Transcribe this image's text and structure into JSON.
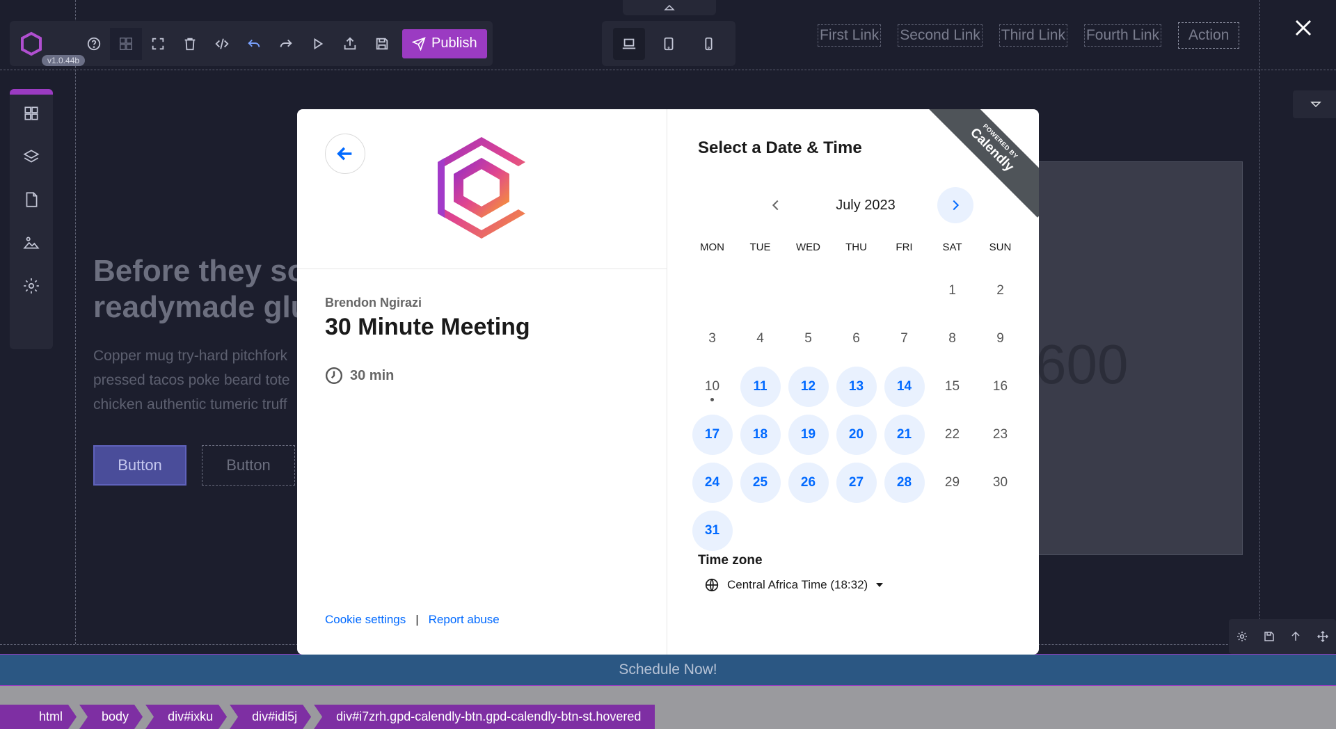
{
  "editor": {
    "version": "v1.0.44b",
    "publish_label": "Publish",
    "nav_links": [
      "First Link",
      "Second Link",
      "Third Link",
      "Fourth Link"
    ],
    "nav_action": "Action",
    "hero_title_line1": "Before they so",
    "hero_title_line2": "readymade glu",
    "hero_text_line1": "Copper mug try-hard pitchfork",
    "hero_text_line2": "pressed tacos poke beard tote",
    "hero_text_line3": "chicken authentic tumeric truff",
    "button_primary": "Button",
    "button_secondary": "Button",
    "stat_number": "600",
    "schedule_label": "Schedule Now!",
    "breadcrumb": [
      "html",
      "body",
      "div#ixku",
      "div#idi5j",
      "div#i7zrh.gpd-calendly-btn.gpd-calendly-btn-st.hovered"
    ],
    "accent_color": "#9b3bc2"
  },
  "calendly": {
    "organizer": "Brendon Ngirazi",
    "event_title": "30 Minute Meeting",
    "duration": "30 min",
    "footer_cookie": "Cookie settings",
    "footer_sep": "|",
    "footer_report": "Report abuse",
    "select_title": "Select a Date & Time",
    "month": "July 2023",
    "weekdays": [
      "MON",
      "TUE",
      "WED",
      "THU",
      "FRI",
      "SAT",
      "SUN"
    ],
    "timezone_label": "Time zone",
    "timezone_value": "Central Africa Time (18:32)",
    "ribbon_small": "POWERED BY",
    "ribbon_big": "Calendly",
    "brand_blue": "#0069ff",
    "days": [
      {
        "d": "",
        "a": false
      },
      {
        "d": "",
        "a": false
      },
      {
        "d": "",
        "a": false
      },
      {
        "d": "",
        "a": false
      },
      {
        "d": "",
        "a": false
      },
      {
        "d": "1",
        "a": false
      },
      {
        "d": "2",
        "a": false
      },
      {
        "d": "3",
        "a": false
      },
      {
        "d": "4",
        "a": false
      },
      {
        "d": "5",
        "a": false
      },
      {
        "d": "6",
        "a": false
      },
      {
        "d": "7",
        "a": false
      },
      {
        "d": "8",
        "a": false
      },
      {
        "d": "9",
        "a": false
      },
      {
        "d": "10",
        "a": false,
        "today": true
      },
      {
        "d": "11",
        "a": true
      },
      {
        "d": "12",
        "a": true
      },
      {
        "d": "13",
        "a": true
      },
      {
        "d": "14",
        "a": true
      },
      {
        "d": "15",
        "a": false
      },
      {
        "d": "16",
        "a": false
      },
      {
        "d": "17",
        "a": true
      },
      {
        "d": "18",
        "a": true
      },
      {
        "d": "19",
        "a": true
      },
      {
        "d": "20",
        "a": true
      },
      {
        "d": "21",
        "a": true
      },
      {
        "d": "22",
        "a": false
      },
      {
        "d": "23",
        "a": false
      },
      {
        "d": "24",
        "a": true
      },
      {
        "d": "25",
        "a": true
      },
      {
        "d": "26",
        "a": true
      },
      {
        "d": "27",
        "a": true
      },
      {
        "d": "28",
        "a": true
      },
      {
        "d": "29",
        "a": false
      },
      {
        "d": "30",
        "a": false
      },
      {
        "d": "31",
        "a": true
      }
    ]
  }
}
